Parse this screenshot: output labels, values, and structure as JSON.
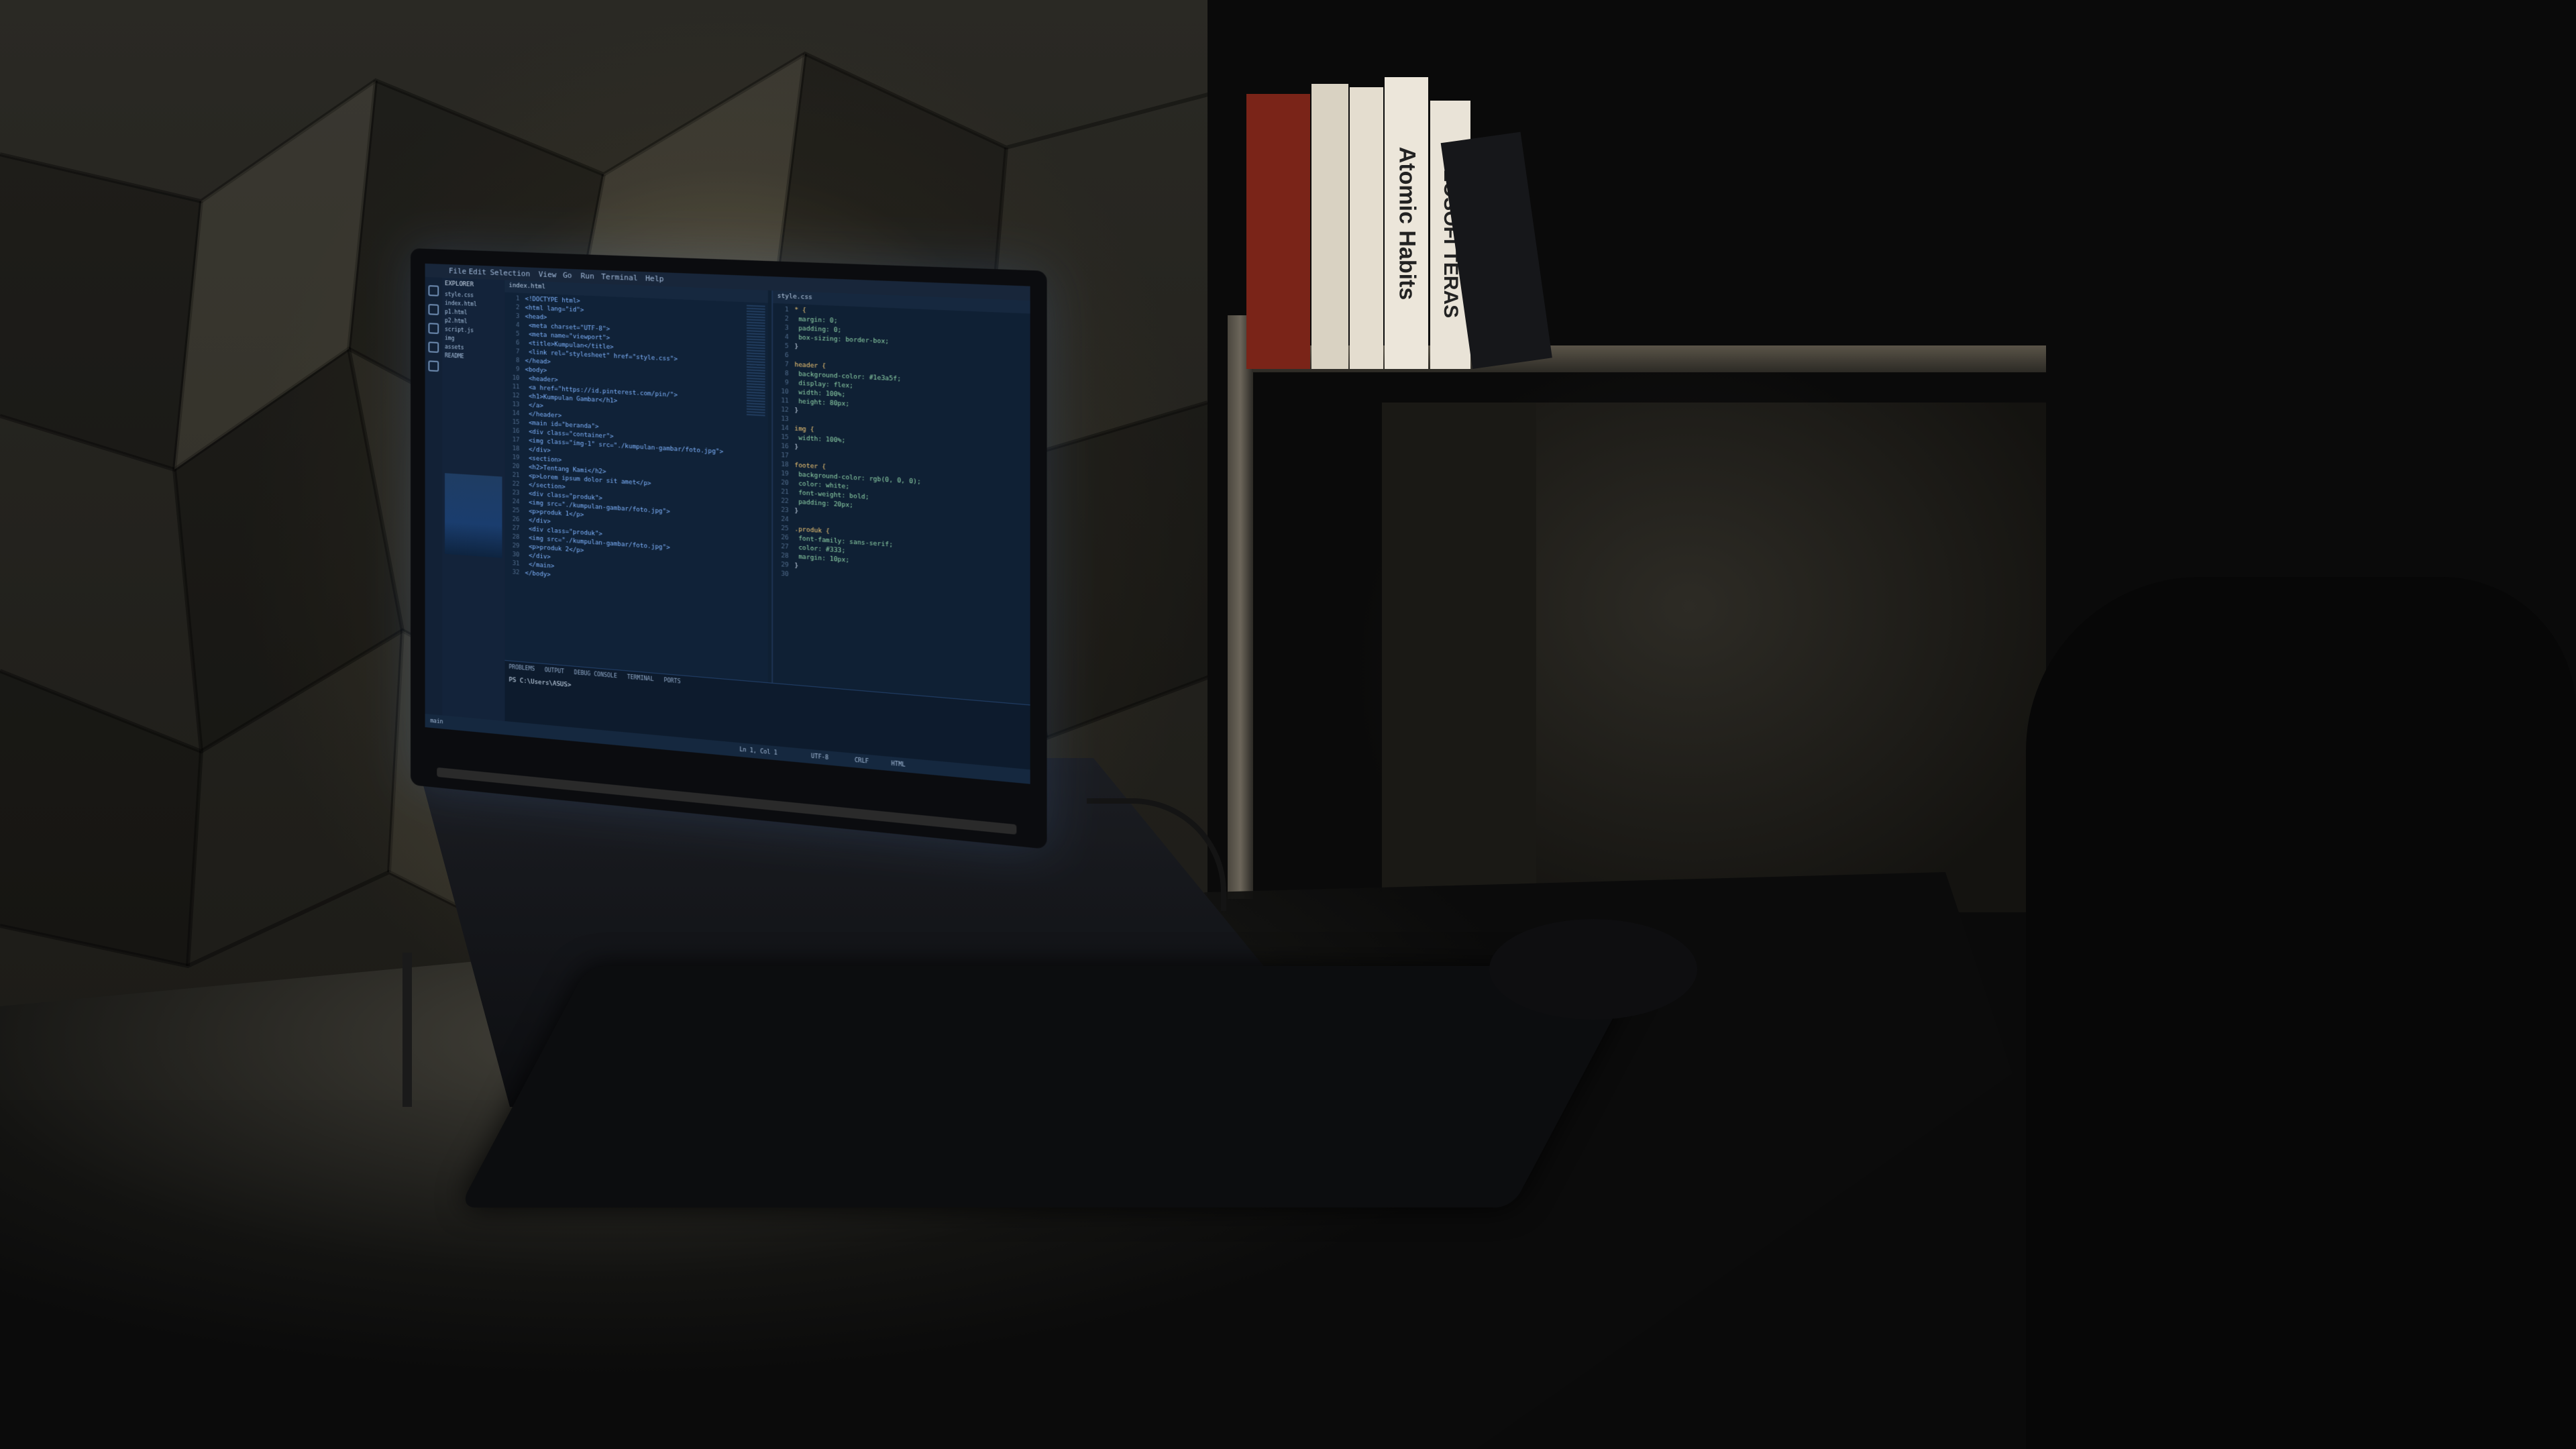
{
  "books": [
    {
      "title": "",
      "color": "#7a2418"
    },
    {
      "title": "",
      "color": "#d9d2c2"
    },
    {
      "title": "",
      "color": "#e4ddcf"
    },
    {
      "title": "Atomic Habits",
      "color": "#ece6da"
    },
    {
      "title": "FILOSOFI TERAS",
      "color": "#e9e3d7"
    }
  ],
  "laptop_screen": {
    "menu": [
      "File",
      "Edit",
      "Selection",
      "View",
      "Go",
      "Run",
      "Terminal",
      "Help"
    ],
    "explorer_title": "EXPLORER",
    "explorer_items": [
      "style.css",
      "index.html",
      "p1.html",
      "p2.html",
      "script.js",
      "img",
      "assets",
      "README"
    ],
    "code_lines": [
      "<!DOCTYPE html>",
      "<html lang=\"id\">",
      "<head>",
      "  <meta charset=\"UTF-8\">",
      "  <meta name=\"viewport\">",
      "  <title>Kumpulan</title>",
      "  <link rel=\"stylesheet\" href=\"style.css\">",
      "</head>",
      "<body>",
      "  <header>",
      "    <a href=\"https://id.pinterest.com/pin/\">",
      "      <h1>Kumpulan Gambar</h1>",
      "    </a>",
      "  </header>",
      "  <main id=\"beranda\">",
      "    <div class=\"container\">",
      "      <img class=\"img-1\" src=\"./kumpulan-gambar/foto.jpg\">",
      "    </div>",
      "    <section>",
      "      <h2>Tentang Kami</h2>",
      "      <p>Lorem ipsum dolor sit amet</p>",
      "    </section>",
      "    <div class=\"produk\">",
      "      <img src=\"./kumpulan-gambar/foto.jpg\">",
      "      <p>produk 1</p>",
      "    </div>",
      "    <div class=\"produk\">",
      "      <img src=\"./kumpulan-gambar/foto.jpg\">",
      "      <p>produk 2</p>",
      "    </div>",
      "  </main>",
      "</body>"
    ],
    "css_lines": [
      "* {",
      "  margin: 0;",
      "  padding: 0;",
      "  box-sizing: border-box;",
      "}",
      "",
      "header {",
      "  background-color: #1e3a5f;",
      "  display: flex;",
      "  width: 100%;",
      "  height: 80px;",
      "}",
      "",
      "img {",
      "  width: 100%;",
      "}",
      "",
      "footer {",
      "  background-color: rgb(0, 0, 0);",
      "  color: white;",
      "  font-weight: bold;",
      "  padding: 20px;",
      "}",
      "",
      ".produk {",
      "  font-family: sans-serif;",
      "  color: #333;",
      "  margin: 10px;",
      "}",
      ""
    ],
    "panel_tabs": [
      "PROBLEMS",
      "OUTPUT",
      "DEBUG CONSOLE",
      "TERMINAL",
      "PORTS"
    ],
    "terminal_prompt": "PS C:\\Users\\ASUS> ",
    "status_items": [
      "main",
      "Ln 1, Col 1",
      "UTF-8",
      "CRLF",
      "HTML"
    ]
  }
}
